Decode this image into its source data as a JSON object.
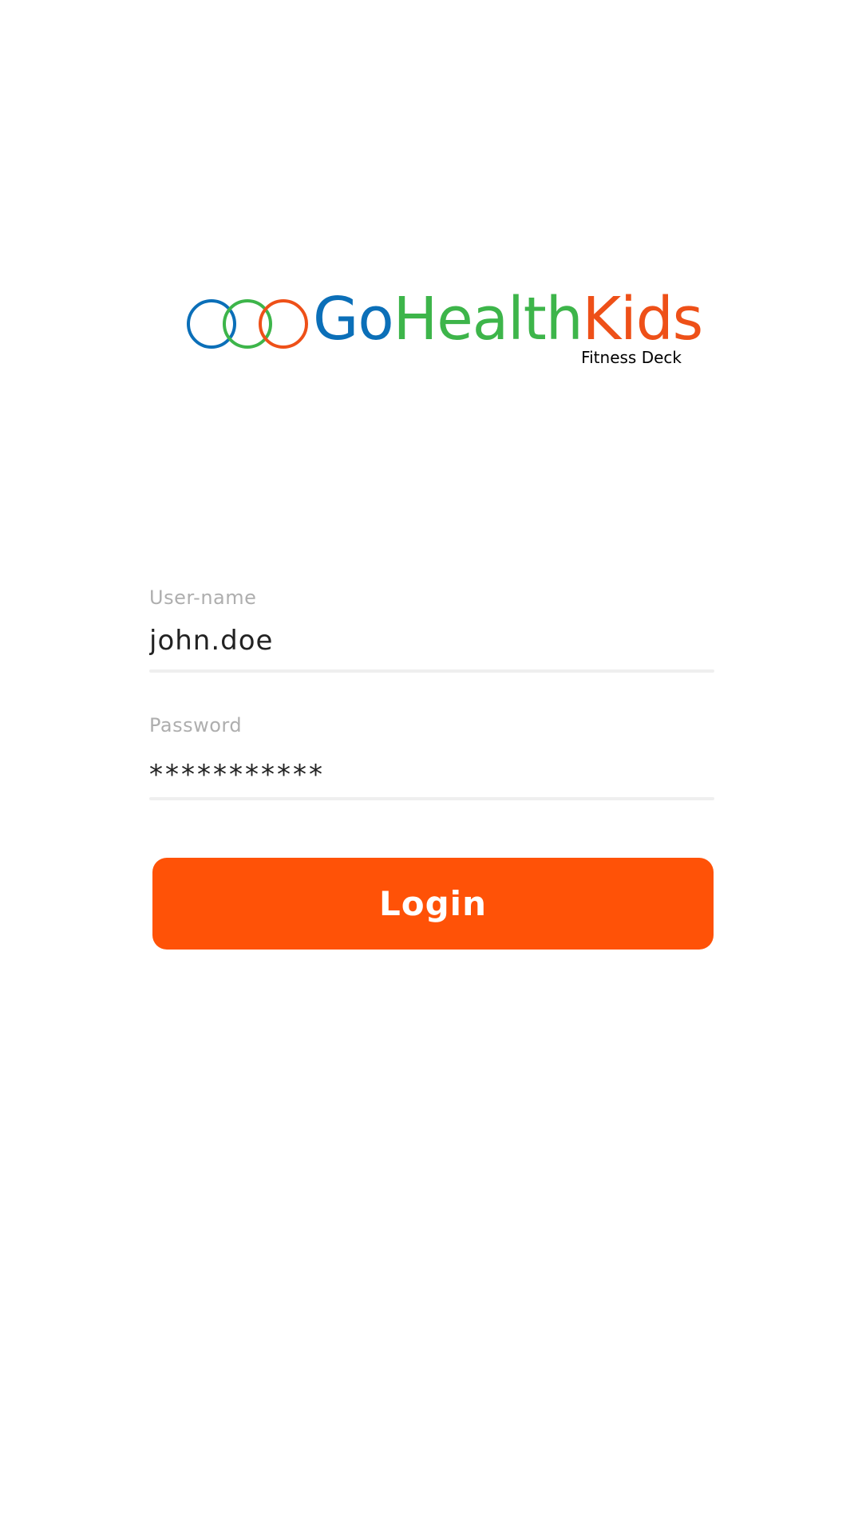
{
  "logo": {
    "word_go": "Go",
    "word_health": "Health",
    "word_kids": "Kids",
    "subtitle": "Fitness Deck",
    "colors": {
      "blue": "#0b6fb8",
      "green": "#3db54a",
      "orange": "#ee5018"
    }
  },
  "form": {
    "username": {
      "label": "User-name",
      "value": "john.doe"
    },
    "password": {
      "label": "Password",
      "value": "***********"
    },
    "login_label": "Login"
  },
  "colors": {
    "accent": "#ff5207",
    "label": "#aeaeae",
    "text": "#222222",
    "underline": "#efefef",
    "background": "#ffffff"
  }
}
